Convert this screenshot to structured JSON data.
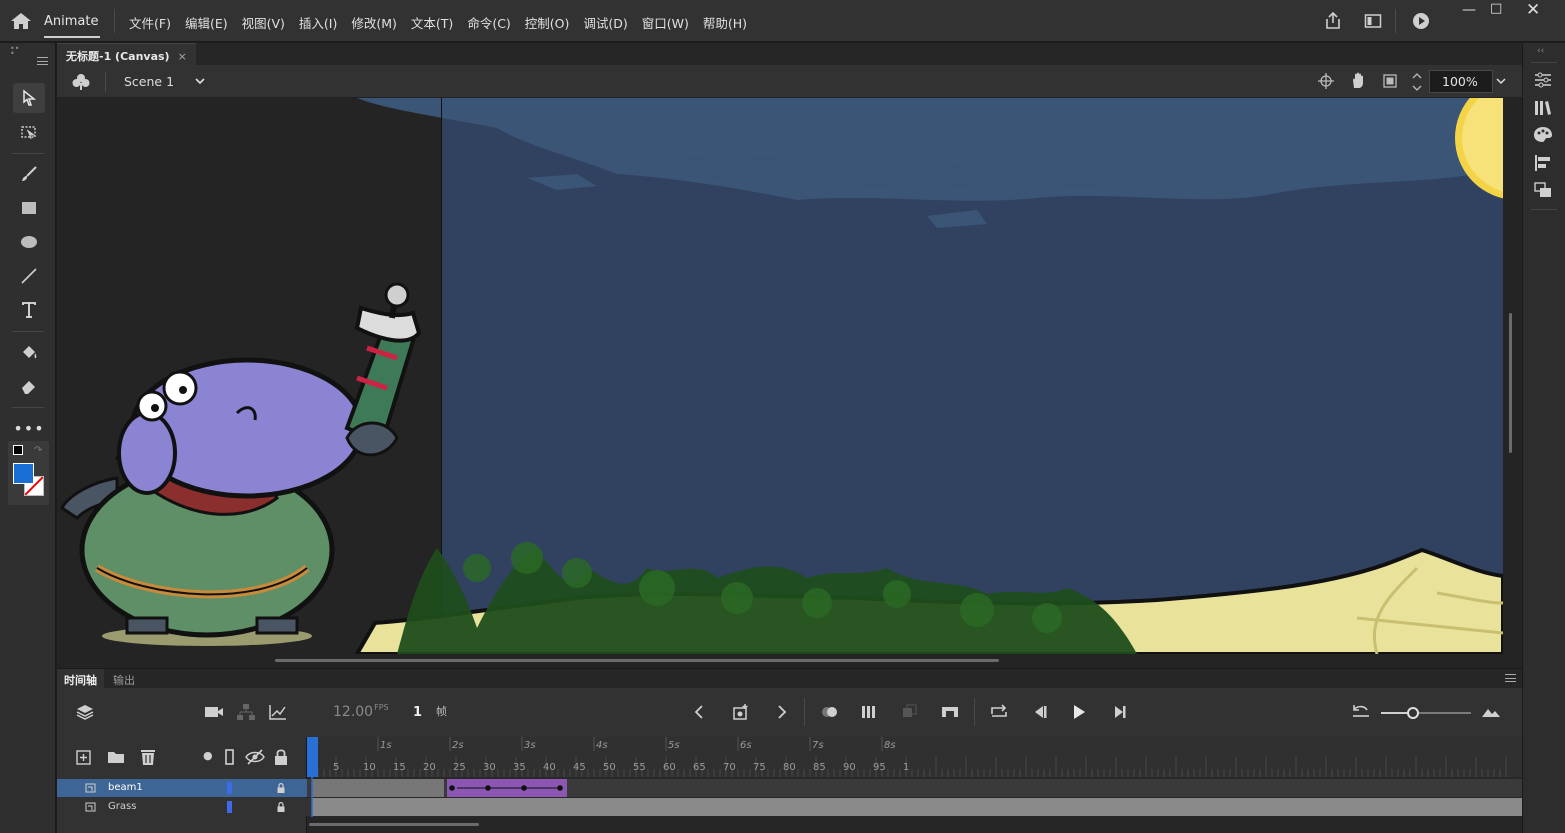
{
  "app": {
    "name": "Animate",
    "menus": [
      "文件(F)",
      "编辑(E)",
      "视图(V)",
      "插入(I)",
      "修改(M)",
      "文本(T)",
      "命令(C)",
      "控制(O)",
      "调试(D)",
      "窗口(W)",
      "帮助(H)"
    ]
  },
  "document": {
    "tab_title": "无标题-1 (Canvas)",
    "tab_close": "×",
    "scene": "Scene 1",
    "zoom": "100%"
  },
  "timeline": {
    "tab_timeline": "时间轴",
    "tab_output": "输出",
    "fps_value": "12.00",
    "fps_unit": "FPS",
    "current_frame": "1",
    "frame_unit": "帧",
    "second_markers": [
      "1s",
      "2s",
      "3s",
      "4s",
      "5s",
      "6s",
      "7s",
      "8s"
    ],
    "frame_numbers": [
      "5",
      "10",
      "15",
      "20",
      "25",
      "30",
      "35",
      "40",
      "45",
      "50",
      "55",
      "60",
      "65",
      "70",
      "75",
      "80",
      "85",
      "90",
      "95",
      "1"
    ],
    "layers": [
      {
        "name": "beam1",
        "selected": true
      },
      {
        "name": "Grass",
        "selected": false
      }
    ],
    "tween_span_frames": [
      23,
      43
    ]
  },
  "colors": {
    "stroke_color": "#1a6fd6",
    "fill_color": "#ffffff",
    "tween_color": "#8c57b3",
    "selected_layer": "#3d6596",
    "sky": "#314260"
  }
}
